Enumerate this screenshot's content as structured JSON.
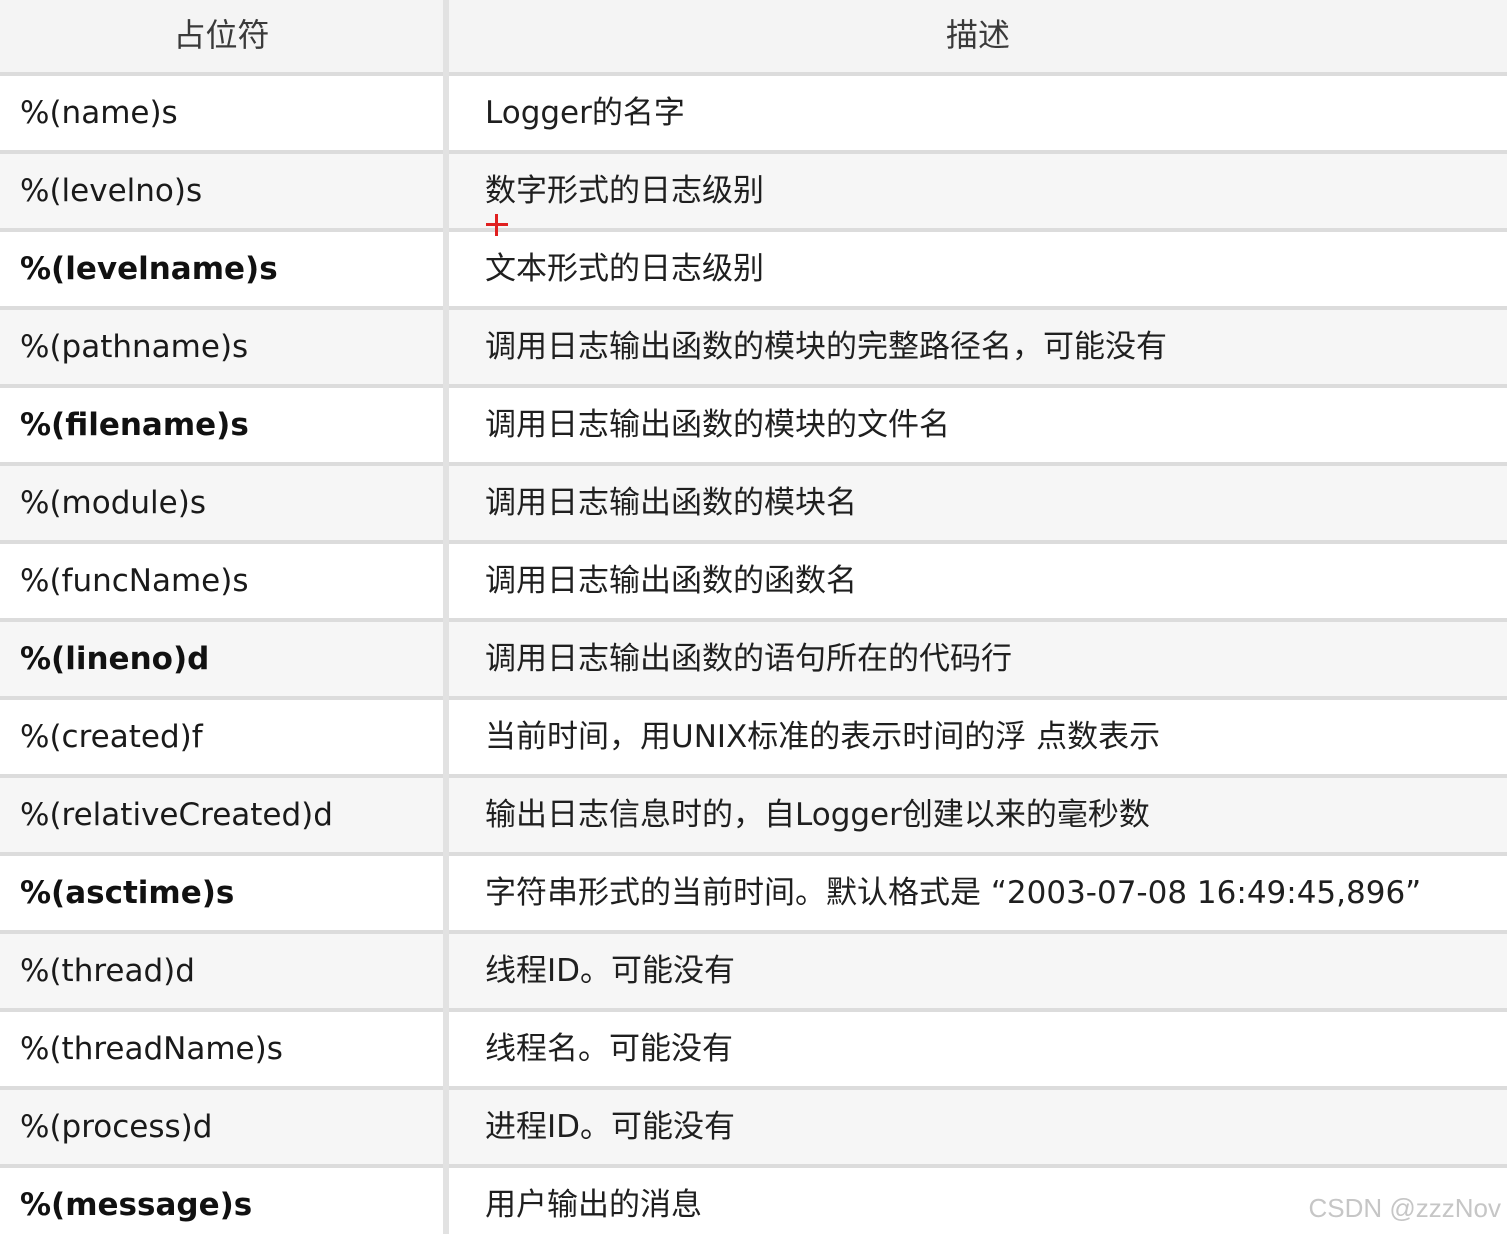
{
  "header": {
    "col_placeholder": "占位符",
    "col_description": "描述"
  },
  "rows": [
    {
      "placeholder": "%(name)s",
      "description": "Logger的名字",
      "bold": false
    },
    {
      "placeholder": "%(levelno)s",
      "description": "数字形式的日志级别",
      "bold": false
    },
    {
      "placeholder": "%(levelname)s",
      "description": "文本形式的日志级别",
      "bold": true
    },
    {
      "placeholder": "%(pathname)s",
      "description": "调用日志输出函数的模块的完整路径名，可能没有",
      "bold": false
    },
    {
      "placeholder": "%(filename)s",
      "description": "调用日志输出函数的模块的文件名",
      "bold": true
    },
    {
      "placeholder": "%(module)s",
      "description": "调用日志输出函数的模块名",
      "bold": false
    },
    {
      "placeholder": "%(funcName)s",
      "description": "调用日志输出函数的函数名",
      "bold": false
    },
    {
      "placeholder": "%(lineno)d",
      "description": "调用日志输出函数的语句所在的代码行",
      "bold": true
    },
    {
      "placeholder": "%(created)f",
      "description": "当前时间，用UNIX标准的表示时间的浮 点数表示",
      "bold": false
    },
    {
      "placeholder": "%(relativeCreated)d",
      "description": "输出日志信息时的，自Logger创建以来的毫秒数",
      "bold": false
    },
    {
      "placeholder": "%(asctime)s",
      "description": "字符串形式的当前时间。默认格式是 “2003-07-08 16:49:45,896”",
      "bold": true
    },
    {
      "placeholder": "%(thread)d",
      "description": "线程ID。可能没有",
      "bold": false
    },
    {
      "placeholder": "%(threadName)s",
      "description": "线程名。可能没有",
      "bold": false
    },
    {
      "placeholder": "%(process)d",
      "description": "进程ID。可能没有",
      "bold": false
    },
    {
      "placeholder": "%(message)s",
      "description": "用户输出的消息",
      "bold": true
    }
  ],
  "watermark": "CSDN @zzzNov",
  "colors": {
    "header_bg": "#f4f4f4",
    "grid_line": "#dcdcdc",
    "cursor_mark": "#e02020"
  }
}
